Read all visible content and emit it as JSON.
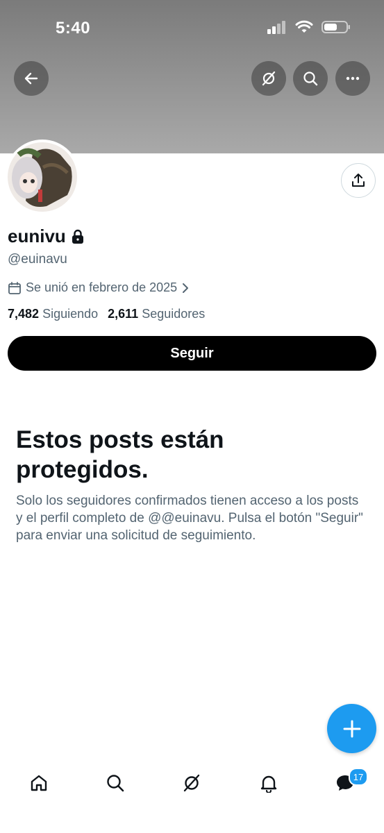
{
  "status_bar": {
    "time": "5:40"
  },
  "profile": {
    "name": "eunivu",
    "handle": "@euinavu",
    "joined": "Se unió en febrero de 2025",
    "following_count": "7,482",
    "following_label": "Siguiendo",
    "followers_count": "2,611",
    "followers_label": "Seguidores",
    "follow_button": "Seguir"
  },
  "protected": {
    "title": "Estos posts están protegidos.",
    "body": "Solo los seguidores confirmados tienen acceso a los posts y el perfil completo de @@euinavu. Pulsa el botón \"Seguir\" para enviar una solicitud de seguimiento."
  },
  "tabbar": {
    "items": [
      "home-icon",
      "search-icon",
      "grok-icon",
      "bell-icon",
      "messages-icon"
    ],
    "messages_badge": "17"
  },
  "colors": {
    "accent": "#1d9bf0",
    "text": "#0f1419",
    "muted": "#536471"
  }
}
